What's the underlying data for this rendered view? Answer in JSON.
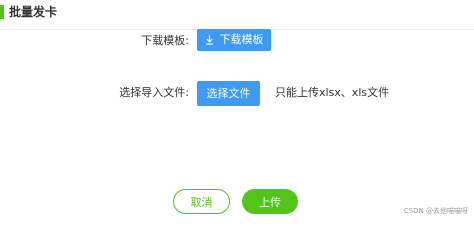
{
  "header": {
    "title": "批量发卡"
  },
  "template_row": {
    "label": "下载模板:",
    "button_label": "下载模板",
    "button_icon": "download-icon"
  },
  "file_row": {
    "label": "选择导入文件:",
    "button_label": "选择文件",
    "hint": "只能上传xlsx、xls文件"
  },
  "footer": {
    "cancel_label": "取消",
    "upload_label": "上传"
  },
  "watermark": "CSDN @去他喵喵呀",
  "colors": {
    "accent_green": "#52c41a",
    "primary_blue": "#3d9bf5"
  }
}
